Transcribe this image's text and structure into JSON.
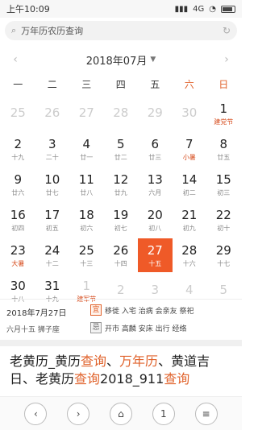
{
  "status_bar": {
    "time": "上午10:09",
    "network": "4G"
  },
  "search": {
    "query": "万年历农历查询"
  },
  "calendar": {
    "month_label": "2018年07月",
    "weekdays": [
      "一",
      "二",
      "三",
      "四",
      "五",
      "六",
      "日"
    ],
    "weeks": [
      [
        {
          "num": "25",
          "lunar": "",
          "faded": true
        },
        {
          "num": "26",
          "lunar": "",
          "faded": true
        },
        {
          "num": "27",
          "lunar": "",
          "faded": true
        },
        {
          "num": "28",
          "lunar": "",
          "faded": true
        },
        {
          "num": "29",
          "lunar": "",
          "faded": true
        },
        {
          "num": "30",
          "lunar": "",
          "faded": true
        },
        {
          "num": "1",
          "lunar": "建党节",
          "festival": true
        }
      ],
      [
        {
          "num": "2",
          "lunar": "十九"
        },
        {
          "num": "3",
          "lunar": "二十"
        },
        {
          "num": "4",
          "lunar": "廿一"
        },
        {
          "num": "5",
          "lunar": "廿二"
        },
        {
          "num": "6",
          "lunar": "廿三"
        },
        {
          "num": "7",
          "lunar": "小暑",
          "festival": true
        },
        {
          "num": "8",
          "lunar": "廿五"
        }
      ],
      [
        {
          "num": "9",
          "lunar": "廿六"
        },
        {
          "num": "10",
          "lunar": "廿七"
        },
        {
          "num": "11",
          "lunar": "廿八"
        },
        {
          "num": "12",
          "lunar": "廿九"
        },
        {
          "num": "13",
          "lunar": "六月"
        },
        {
          "num": "14",
          "lunar": "初二"
        },
        {
          "num": "15",
          "lunar": "初三"
        }
      ],
      [
        {
          "num": "16",
          "lunar": "初四"
        },
        {
          "num": "17",
          "lunar": "初五"
        },
        {
          "num": "18",
          "lunar": "初六"
        },
        {
          "num": "19",
          "lunar": "初七"
        },
        {
          "num": "20",
          "lunar": "初八"
        },
        {
          "num": "21",
          "lunar": "初九"
        },
        {
          "num": "22",
          "lunar": "初十"
        }
      ],
      [
        {
          "num": "23",
          "lunar": "大暑",
          "festival": true
        },
        {
          "num": "24",
          "lunar": "十二"
        },
        {
          "num": "25",
          "lunar": "十三"
        },
        {
          "num": "26",
          "lunar": "十四"
        },
        {
          "num": "27",
          "lunar": "十五",
          "selected": true
        },
        {
          "num": "28",
          "lunar": "十六"
        },
        {
          "num": "29",
          "lunar": "十七"
        }
      ],
      [
        {
          "num": "30",
          "lunar": "十八"
        },
        {
          "num": "31",
          "lunar": "十九"
        },
        {
          "num": "1",
          "lunar": "建军节",
          "faded": true,
          "festival": true
        },
        {
          "num": "2",
          "lunar": "",
          "faded": true
        },
        {
          "num": "3",
          "lunar": "",
          "faded": true
        },
        {
          "num": "4",
          "lunar": "",
          "faded": true
        },
        {
          "num": "5",
          "lunar": "",
          "faded": true
        }
      ]
    ]
  },
  "info": {
    "date": "2018年7月27日",
    "lunar": "六月十五 狮子座",
    "yi_tag": "宜",
    "yi_text": "移徙 入宅 治病 会亲友 祭祀",
    "ji_tag": "忌",
    "ji_text": "开市 高麟 安床 出行 经络"
  },
  "result": {
    "segments": [
      {
        "text": "老黄历_黄历",
        "hl": false
      },
      {
        "text": "查询",
        "hl": true
      },
      {
        "text": "、",
        "hl": false
      },
      {
        "text": "万年历",
        "hl": true
      },
      {
        "text": "、黄道吉日、老黄历",
        "hl": false
      },
      {
        "text": "查询",
        "hl": true
      },
      {
        "text": "2018_911",
        "hl": false
      },
      {
        "text": "查询",
        "hl": true
      }
    ]
  },
  "bottom_nav": {
    "back": "‹",
    "forward": "›",
    "home": "⌂",
    "tabs": "1",
    "menu": "≡"
  },
  "colors": {
    "accent": "#ef5a28",
    "festival": "#d64a1a"
  }
}
